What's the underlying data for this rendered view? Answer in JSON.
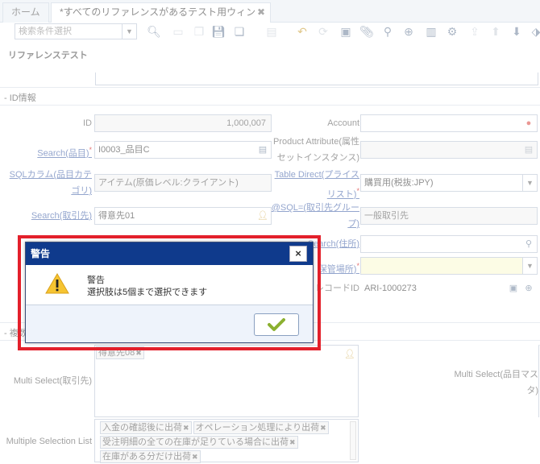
{
  "tabs": {
    "home": "ホーム",
    "active": "*すべてのリファレンスがあるテスト用ウィンドウ"
  },
  "toolbar": {
    "query_placeholder": "検索条件選択"
  },
  "window": {
    "title": "リファレンステスト",
    "section_id": "- ID情報",
    "section_multi": "- 複数"
  },
  "form": {
    "id_label": "ID",
    "id_value": "1,000,007",
    "account_label": "Account",
    "account_value": "",
    "search_product_label": "Search(品目)",
    "search_product_value": "I0003_品目C",
    "product_attr_label_1": "Product Attribute(属性",
    "product_attr_label_2": "セットインスタンス)",
    "sql_label_1": "SQLカラム(品目カテ",
    "sql_label_2": "ゴリ)",
    "sql_value": "アイテム(原価レベル:クライアント)",
    "table_direct_label_1": "Table Direct(プライス",
    "table_direct_label_2": "リスト)",
    "table_direct_value": "購買用(税抜:JPY)",
    "search_bp_label": "Search(取引先)",
    "search_bp_value": "得意先01",
    "sql_bpgroup_label_1": "@SQL=(取引先グルー",
    "sql_bpgroup_label_2": "プ)",
    "sql_bpgroup_value": "一般取引先",
    "search_location_label": "Search(住所)",
    "warehouse_label": "保管場所)",
    "record_id_label": "レコードID",
    "record_id_value": "ARI-1000273",
    "multi_bp_label": "Multi Select(取引先)",
    "multi_bp_chips": [
      "得意先08"
    ],
    "multi_product_label_1": "Multi Select(品目マス",
    "multi_product_label_2": "タ)",
    "multiple_selection_label": "Multiple Selection List",
    "multiple_selection_chips": [
      "入金の確認後に出荷",
      "オペレーション処理により出荷",
      "受注明細の全ての在庫が足りている場合に出荷",
      "在庫がある分だけ出荷"
    ]
  },
  "dialog": {
    "header": "警告",
    "title": "警告",
    "message": "選択肢は5個まで選択できます",
    "close": "×"
  },
  "colors": {
    "dialog_header": "#0f3a8c",
    "highlight_frame": "#e3202b",
    "ok_check": "#8bb030"
  }
}
